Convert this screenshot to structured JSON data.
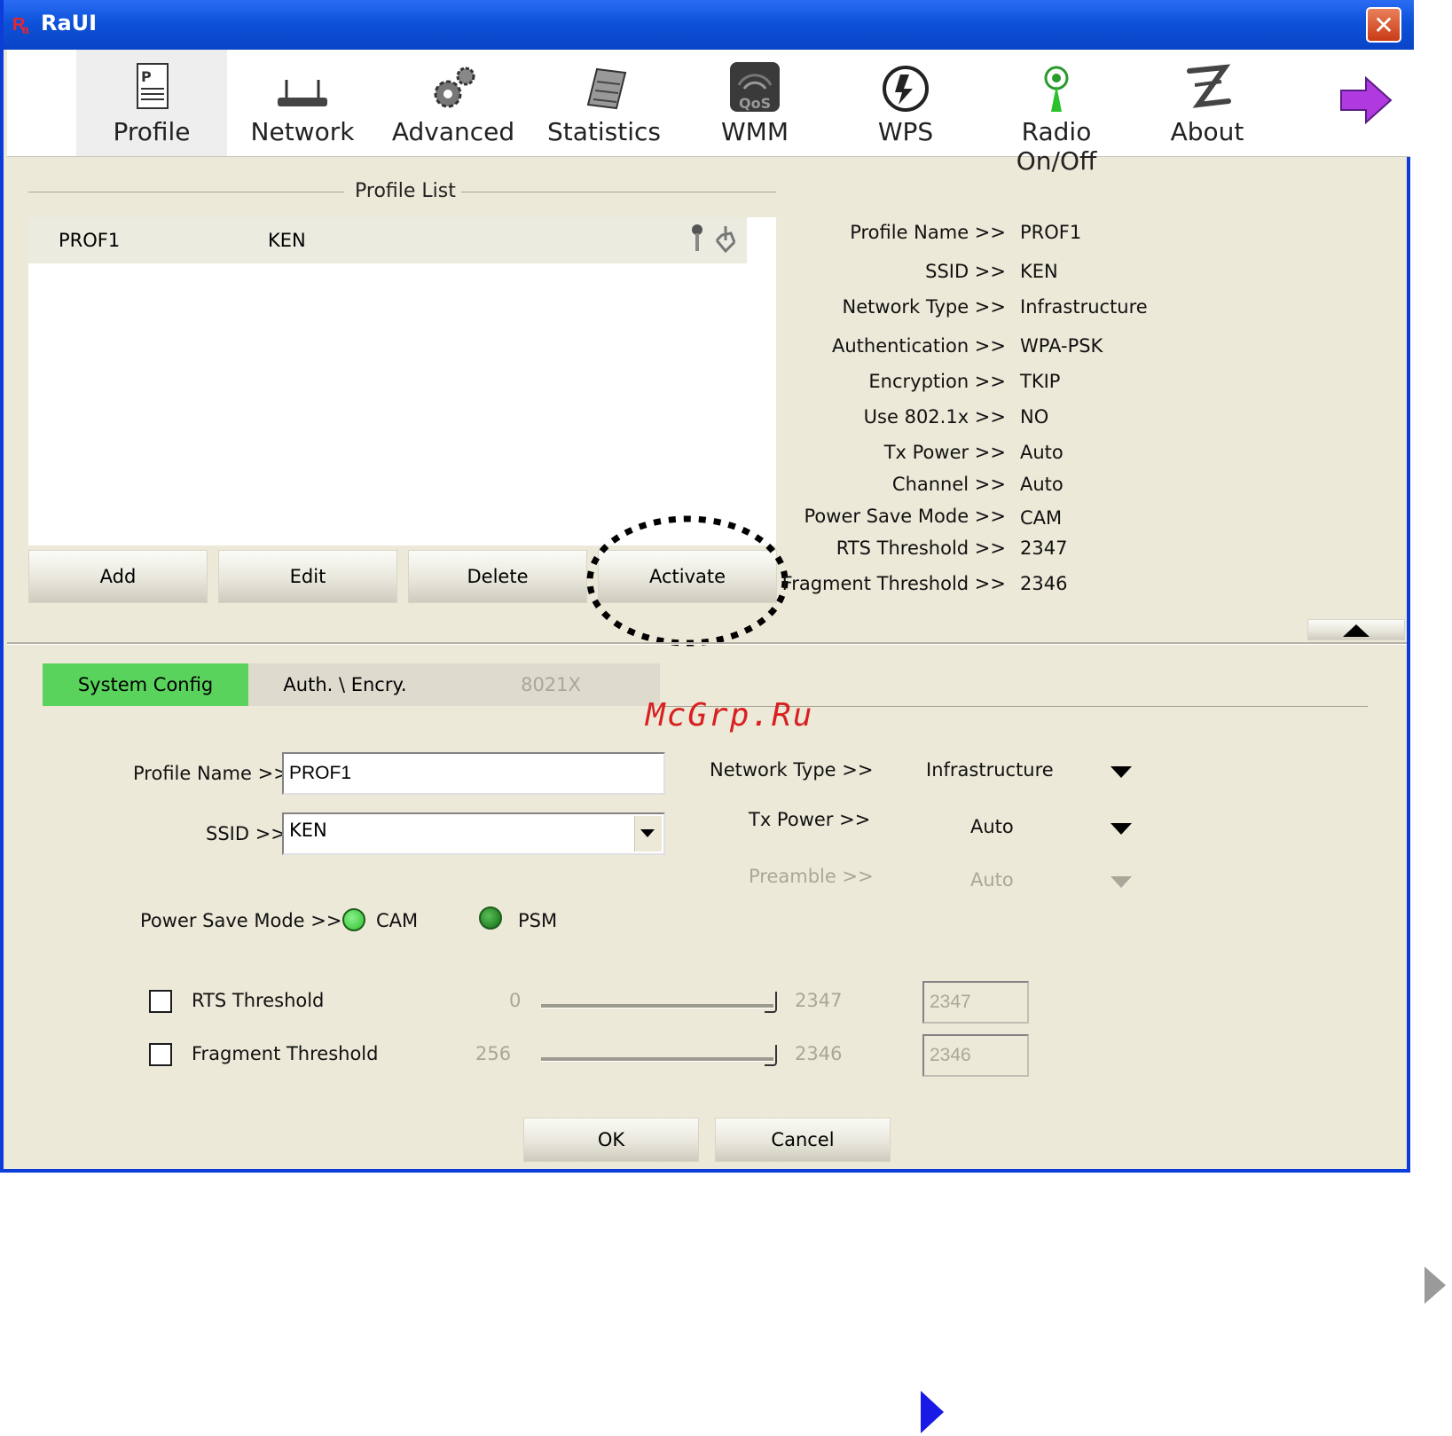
{
  "window": {
    "title": "RaUI",
    "close_glyph": "✕"
  },
  "toolbar": {
    "items": [
      {
        "label": "Profile",
        "icon": "profile-icon"
      },
      {
        "label": "Network",
        "icon": "network-icon"
      },
      {
        "label": "Advanced",
        "icon": "advanced-icon"
      },
      {
        "label": "Statistics",
        "icon": "statistics-icon"
      },
      {
        "label": "WMM",
        "icon": "wmm-qos-icon"
      },
      {
        "label": "WPS",
        "icon": "wps-icon"
      },
      {
        "label": "Radio On/Off",
        "icon": "radio-icon"
      },
      {
        "label": "About",
        "icon": "about-icon"
      }
    ],
    "more_icon": "arrow-right-icon"
  },
  "profile_list": {
    "title": "Profile List",
    "rows": [
      {
        "profile": "PROF1",
        "ssid": "KEN"
      }
    ],
    "buttons": {
      "add": "Add",
      "edit": "Edit",
      "delete": "Delete",
      "activate": "Activate"
    }
  },
  "details": [
    {
      "label": "Profile Name >>",
      "value": "PROF1"
    },
    {
      "label": "SSID >>",
      "value": "KEN"
    },
    {
      "label": "Network Type >>",
      "value": "Infrastructure"
    },
    {
      "label": "Authentication >>",
      "value": "WPA-PSK"
    },
    {
      "label": "Encryption >>",
      "value": "TKIP"
    },
    {
      "label": "Use 802.1x >>",
      "value": "NO"
    },
    {
      "label": "Tx Power >>",
      "value": "Auto"
    },
    {
      "label": "Channel >>",
      "value": "Auto"
    },
    {
      "label": "Power Save Mode >>",
      "value": "CAM"
    },
    {
      "label": "RTS Threshold >>",
      "value": "2347"
    },
    {
      "label": "Fragment Threshold >>",
      "value": "2346"
    }
  ],
  "tabs": {
    "system_config": "System Config",
    "auth_encry": "Auth. \\ Encry.",
    "dot1x": "8021X"
  },
  "watermark": "McGrp.Ru",
  "form": {
    "profile_name_label": "Profile Name >>",
    "profile_name_value": "PROF1",
    "ssid_label": "SSID >>",
    "ssid_value": "KEN",
    "network_type_label": "Network Type >>",
    "network_type_value": "Infrastructure",
    "tx_power_label": "Tx Power >>",
    "tx_power_value": "Auto",
    "preamble_label": "Preamble >>",
    "preamble_value": "Auto",
    "power_save_label": "Power Save Mode >>",
    "cam_label": "CAM",
    "psm_label": "PSM",
    "rts_label": "RTS Threshold",
    "rts_min": "0",
    "rts_max": "2347",
    "rts_value": "2347",
    "frag_label": "Fragment Threshold",
    "frag_min": "256",
    "frag_max": "2346",
    "frag_value": "2346",
    "ok": "OK",
    "cancel": "Cancel"
  },
  "colors": {
    "title_bar": "#0d52d9",
    "active_tab": "#59d35c",
    "panel": "#ece9d8",
    "watermark": "#d92020",
    "nav_arrow": "#1a1ae6"
  }
}
